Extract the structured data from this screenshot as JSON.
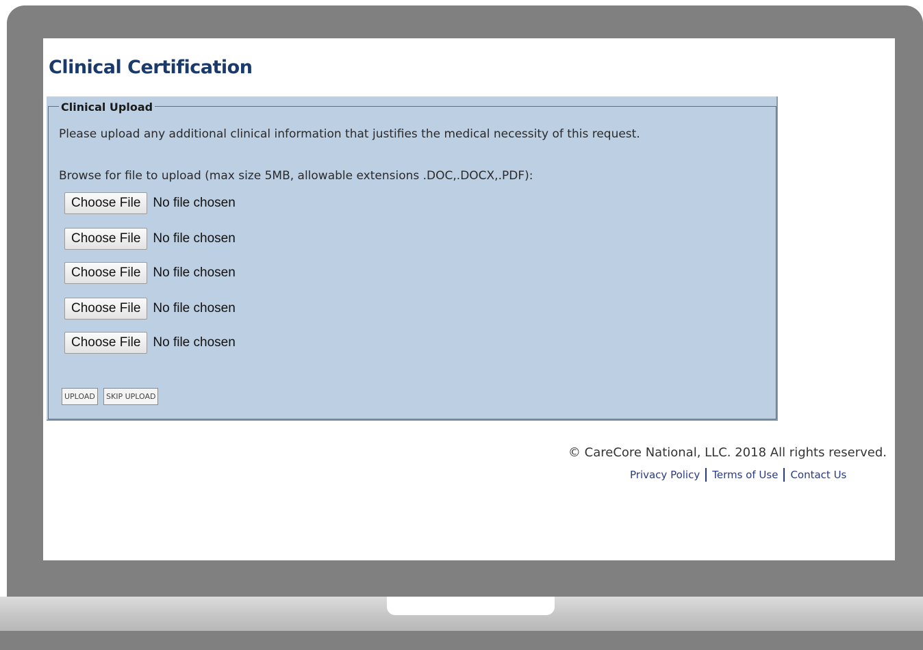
{
  "page": {
    "title": "Clinical Certification"
  },
  "upload_section": {
    "legend": "Clinical Upload",
    "instruction": "Please upload any additional clinical information that justifies the medical necessity of this request.",
    "browse_label": "Browse for file to upload (max size 5MB, allowable extensions .DOC,.DOCX,.PDF):",
    "file_inputs": [
      {
        "button_label": "Choose File",
        "status": "No file chosen"
      },
      {
        "button_label": "Choose File",
        "status": "No file chosen"
      },
      {
        "button_label": "Choose File",
        "status": "No file chosen"
      },
      {
        "button_label": "Choose File",
        "status": "No file chosen"
      },
      {
        "button_label": "Choose File",
        "status": "No file chosen"
      }
    ],
    "upload_button": "UPLOAD",
    "skip_button": "SKIP UPLOAD"
  },
  "footer": {
    "copyright": "© CareCore National, LLC. 2018 All rights reserved.",
    "links": [
      "Privacy Policy",
      "Terms of Use",
      "Contact Us"
    ]
  },
  "colors": {
    "title": "#1a3a6b",
    "panel_background": "#bccfe3",
    "laptop_frame": "#808080",
    "link": "#2a3a80"
  }
}
